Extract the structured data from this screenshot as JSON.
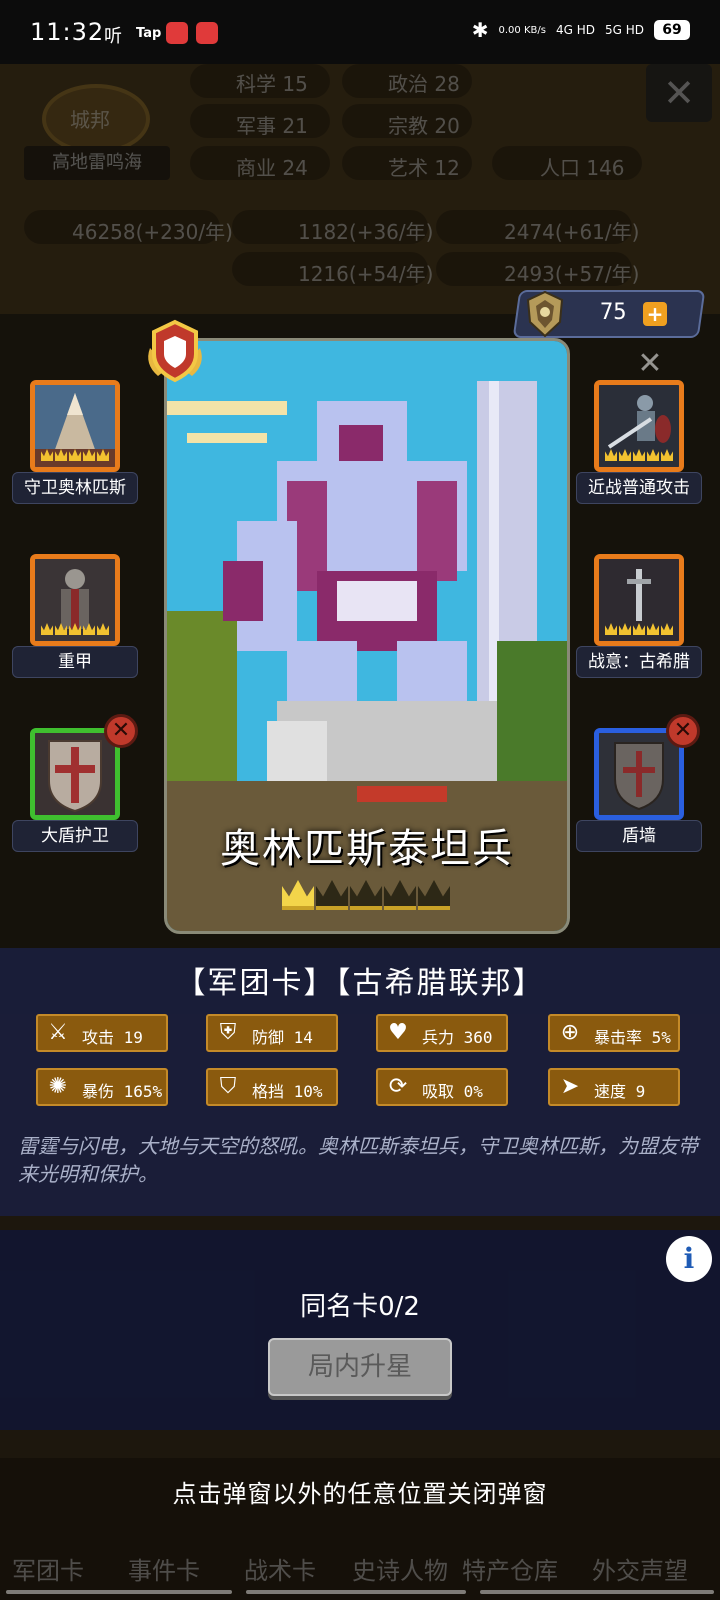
{
  "status_bar": {
    "time": "11:32",
    "app_icons": [
      "听",
      "Tap"
    ],
    "net_speed": "0.00 KB/s",
    "signal1": "4G HD",
    "signal2": "5G HD",
    "battery": "69"
  },
  "background": {
    "city_emblem": "城邦",
    "city_name": "高地雷鸣海",
    "stats": [
      "科学 15",
      "政治 28",
      "军事 21",
      "宗教 20",
      "商业 24",
      "艺术 12",
      "人口 146"
    ],
    "resources": [
      "46258(+230/年)",
      "1182(+36/年)",
      "2474(+61/年)",
      "1216(+54/年)",
      "2493(+57/年)"
    ],
    "nav": [
      "军团卡",
      "事件卡",
      "战术卡",
      "史诗人物",
      "特产仓库",
      "外交声望"
    ]
  },
  "currency": {
    "value": "75",
    "plus": "+"
  },
  "skills": [
    {
      "label": "守卫奥林匹斯",
      "stars": 5,
      "frame": "orange"
    },
    {
      "label": "近战普通攻击",
      "stars": 5,
      "frame": "orange"
    },
    {
      "label": "重甲",
      "stars": 5,
      "frame": "orange"
    },
    {
      "label": "战意：古希腊",
      "stars": 5,
      "frame": "orange"
    },
    {
      "label": "大盾护卫",
      "stars": 0,
      "frame": "green"
    },
    {
      "label": "盾墙",
      "stars": 0,
      "frame": "blue"
    }
  ],
  "card": {
    "name": "奥林匹斯泰坦兵",
    "stars_filled": 1,
    "stars_total": 5,
    "type_line": "【军团卡】【古希腊联邦】"
  },
  "stats": [
    {
      "icon": "sword-icon",
      "label": "攻击 19"
    },
    {
      "icon": "shield-icon",
      "label": "防御 14"
    },
    {
      "icon": "heart-icon",
      "label": "兵力 360"
    },
    {
      "icon": "crosshair-icon",
      "label": "暴击率 5%"
    },
    {
      "icon": "crit-damage-icon",
      "label": "暴伤 165%"
    },
    {
      "icon": "block-icon",
      "label": "格挡 10%"
    },
    {
      "icon": "lifesteal-icon",
      "label": "吸取 0%"
    },
    {
      "icon": "boot-icon",
      "label": "速度 9"
    }
  ],
  "description": "雷霆与闪电，大地与天空的怒吼。奥林匹斯泰坦兵，守卫奥林匹斯，为盟友带来光明和保护。",
  "same_card": "同名卡0/2",
  "upgrade_button": "局内升星",
  "close_hint": "点击弹窗以外的任意位置关闭弹窗",
  "colors": {
    "panel": "#1a1e3a",
    "stat_bg": "#8a5a0e",
    "accent_orange": "#e87b1b"
  }
}
